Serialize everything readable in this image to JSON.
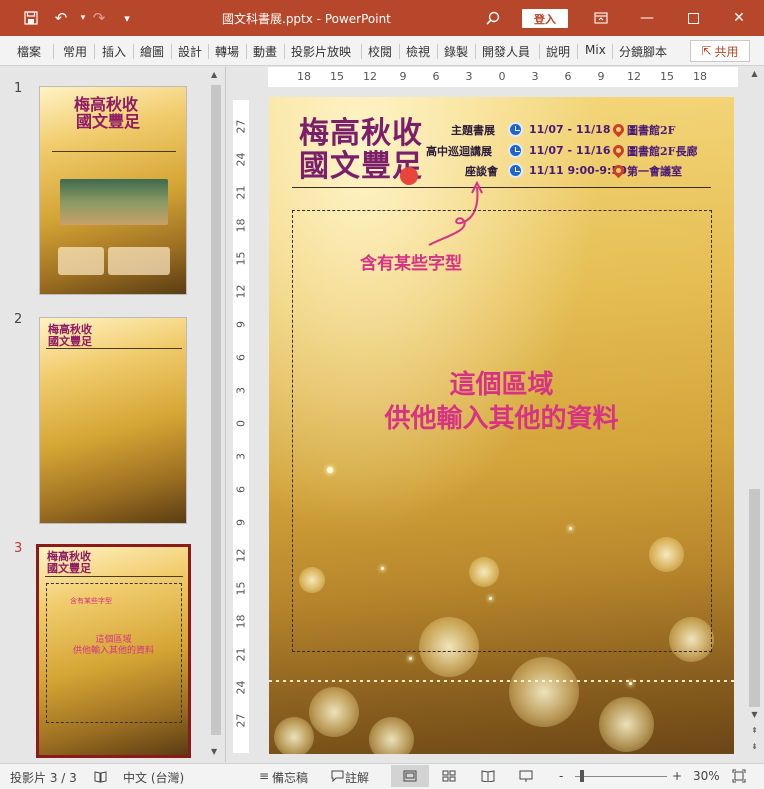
{
  "app": {
    "file_title": "國文科書展.pptx  -  PowerPoint",
    "signin_label": "登入"
  },
  "quick_access": {
    "save_icon": "save-icon",
    "undo_icon": "undo-icon",
    "redo_icon": "redo-icon",
    "customize_icon": "chevron-down-icon"
  },
  "ribbon": {
    "tabs": [
      "檔案",
      "常用",
      "插入",
      "繪圖",
      "設計",
      "轉場",
      "動畫",
      "投影片放映",
      "校閱",
      "檢視",
      "錄製",
      "開發人員",
      "說明",
      "Mix",
      "分鏡腳本"
    ],
    "share_label": "共用"
  },
  "thumbnails": {
    "numbers": [
      "1",
      "2",
      "3"
    ],
    "t3_small1": "含有某些字型",
    "t3_small2": "這個區域",
    "t3_small3": "供他輸入其他的資料"
  },
  "hruler": [
    "18",
    "15",
    "12",
    "9",
    "6",
    "3",
    "0",
    "3",
    "6",
    "9",
    "12",
    "15",
    "18"
  ],
  "vruler": [
    "27",
    "24",
    "21",
    "18",
    "15",
    "12",
    "9",
    "6",
    "3",
    "0",
    "3",
    "6",
    "9",
    "12",
    "15",
    "18",
    "21",
    "24",
    "27"
  ],
  "slide": {
    "logo_line1": "梅高秋收",
    "logo_line2": "國文豐足",
    "events": [
      {
        "name": "主題書展",
        "date": "11/07 - 11/18",
        "place": "圖書館2F"
      },
      {
        "name": "高中巡迴講展",
        "date": "11/07 - 11/16",
        "place": "圖書館2F長廊"
      },
      {
        "name": "座談會",
        "date": "11/11 9:00-9:50",
        "place": "第一會議室"
      }
    ],
    "note_font": "含有某些字型",
    "note_area_1": "這個區域",
    "note_area_2": "供他輸入其他的資料"
  },
  "status": {
    "slide_count": "投影片 3 / 3",
    "language": "中文 (台灣)",
    "notes_label": "備忘稿",
    "comments_label": "註解",
    "zoom_minus": "-",
    "zoom_plus": "+",
    "zoom": "30%"
  },
  "colors": {
    "accent": "#b7472a",
    "slide_text_pink": "#d63384",
    "logo_purple": "#7b1f6a"
  }
}
